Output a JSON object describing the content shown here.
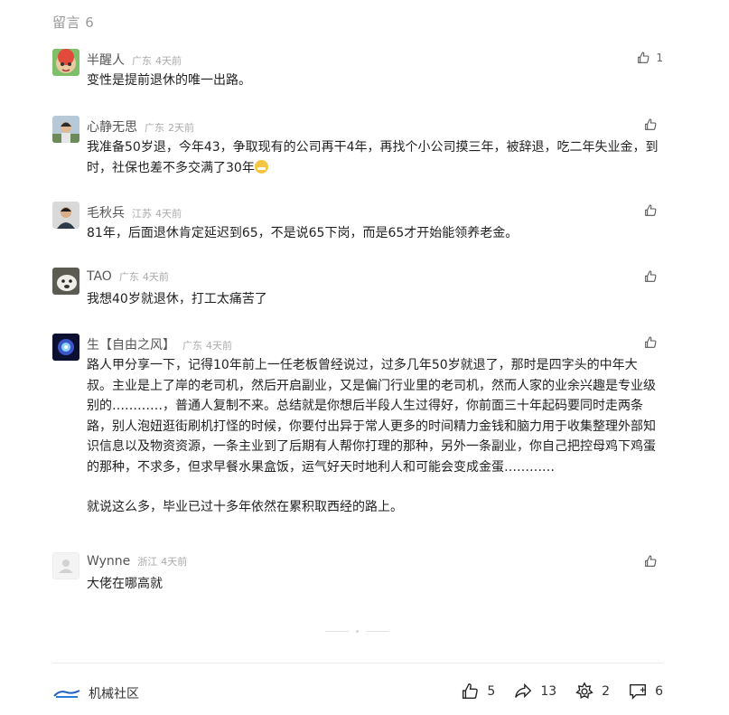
{
  "header": {
    "title": "留言 6"
  },
  "comments": [
    {
      "name": "半醒人",
      "region": "广东",
      "time": "4天前",
      "likes": "1",
      "text": [
        "变性是提前退休的唯一出路。"
      ]
    },
    {
      "name": "心静无思",
      "region": "广东",
      "time": "2天前",
      "likes": "",
      "text": [
        "我准备50岁退，今年43，争取现有的公司再干4年，再找个小公司摸三年，被辞退，吃二年失业金，到时，社保也差不多交满了30年"
      ]
    },
    {
      "name": "毛秋兵",
      "region": "江苏",
      "time": "4天前",
      "likes": "",
      "text": [
        "81年，后面退休肯定延迟到65，不是说65下岗，而是65才开始能领养老金。"
      ]
    },
    {
      "name": "TAO",
      "region": "广东",
      "time": "4天前",
      "likes": "",
      "text": [
        "我想40岁就退休，打工太痛苦了"
      ]
    },
    {
      "name": "生【自由之风】",
      "region": "广东",
      "time": "4天前",
      "likes": "",
      "text": [
        "路人甲分享一下，记得10年前上一任老板曾经说过，过多几年50岁就退了，那时是四字头的中年大叔。主业是上了岸的老司机，然后开启副业，又是偏门行业里的老司机，然而人家的业余兴趣是专业级别的…………，普通人复制不来。总结就是你想后半段人生过得好，你前面三十年起码要同时走两条路，别人泡妞逛街刷机打怪的时候，你要付出异于常人更多的时间精力金钱和脑力用于收集整理外部知识信息以及物资资源，一条主业到了后期有人帮你打理的那种，另外一条副业，你自己把控母鸡下鸡蛋的那种，不求多，但求早餐水果盒饭，运气好天时地利人和可能会变成金蛋…………",
        "就说这么多，毕业已过十多年依然在累积取西经的路上。"
      ]
    },
    {
      "name": "Wynne",
      "region": "浙江",
      "time": "4天前",
      "likes": "",
      "text": [
        "大佬在哪高就"
      ]
    }
  ],
  "footer": {
    "source": "机械社区",
    "actions": [
      {
        "icon": "thumbs-up-icon",
        "count": "5"
      },
      {
        "icon": "share-icon",
        "count": "13"
      },
      {
        "icon": "star-icon",
        "count": "2"
      },
      {
        "icon": "comment-icon",
        "count": "6"
      }
    ]
  }
}
